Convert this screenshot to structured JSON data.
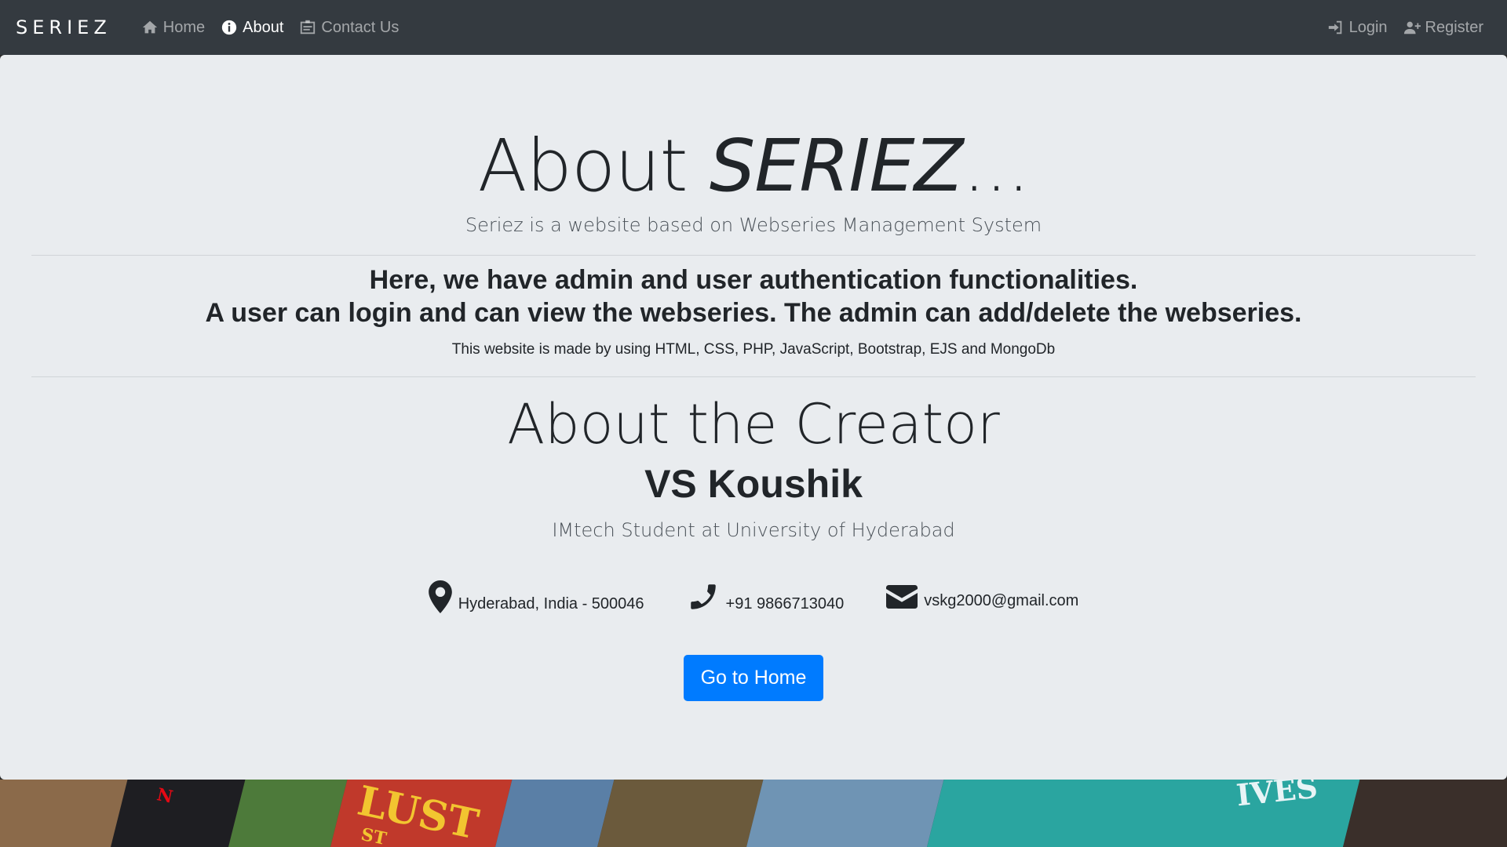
{
  "nav": {
    "brand": "SERIEZ",
    "links": [
      {
        "label": "Home",
        "icon": "home-icon"
      },
      {
        "label": "About",
        "icon": "info-icon"
      },
      {
        "label": "Contact Us",
        "icon": "contact-card-icon"
      }
    ],
    "right_links": [
      {
        "label": "Login",
        "icon": "sign-in-icon"
      },
      {
        "label": "Register",
        "icon": "user-plus-icon"
      }
    ]
  },
  "about": {
    "title_prefix": "About ",
    "title_brand": "SERIEZ",
    "title_suffix": "...",
    "lead": "Seriez is a website based on Webseries Management System",
    "feature_line1": "Here, we have admin and user authentication functionalities.",
    "feature_line2": "A user can login and can view the webseries. The admin can add/delete the webseries.",
    "made_with": "This website is made by using HTML, CSS, PHP, JavaScript, Bootstrap, EJS and MongoDb"
  },
  "creator": {
    "heading": "About the Creator",
    "name": "VS Koushik",
    "role": "IMtech Student at University of Hyderabad",
    "location": "Hyderabad, India - 500046",
    "phone": "+91 9866713040",
    "email": "vskg2000@gmail.com"
  },
  "button": {
    "label": "Go to Home"
  },
  "banner": {
    "poster_text_1": "LUST",
    "poster_text_2": "ST",
    "poster_text_3": "N",
    "poster_text_4": "IVES"
  },
  "colors": {
    "navbar": "#343a40",
    "jumbotron": "#e9ecef",
    "primary": "#007bff"
  }
}
